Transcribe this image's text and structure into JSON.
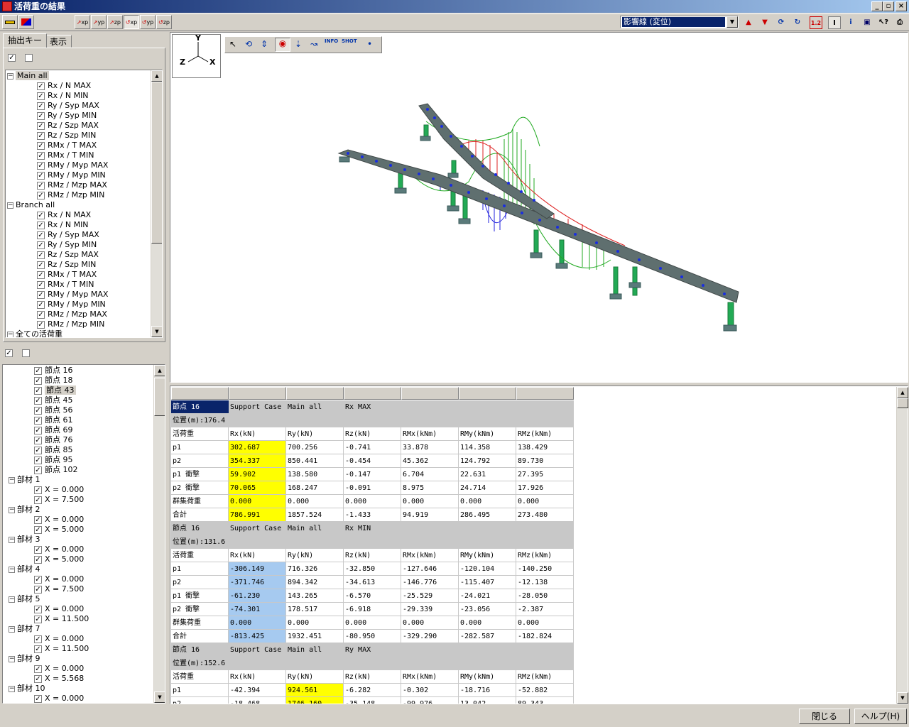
{
  "window": {
    "title": "活荷重の結果",
    "minimize": "_",
    "maximize": "▫",
    "close": "×"
  },
  "toolbar": {
    "axis_buttons": [
      "xp",
      "yp",
      "zp",
      "xp",
      "yp",
      "zp"
    ],
    "combo_value": "影響線 (変位)",
    "view_buttons": [
      "",
      "",
      "",
      "",
      "",
      "",
      "",
      "",
      "",
      "INFO",
      "SHOT",
      "•"
    ]
  },
  "tabs": [
    "抽出キー",
    "表示"
  ],
  "tree_top": {
    "groups": [
      {
        "label": "Main all",
        "items": [
          "Rx / N MAX",
          "Rx / N MIN",
          "Ry / Syp MAX",
          "Ry / Syp MIN",
          "Rz / Szp MAX",
          "Rz / Szp MIN",
          "RMx / T MAX",
          "RMx / T MIN",
          "RMy / Myp MAX",
          "RMy / Myp MIN",
          "RMz / Mzp MAX",
          "RMz / Mzp MIN"
        ]
      },
      {
        "label": "Branch all",
        "items": [
          "Rx / N MAX",
          "Rx / N MIN",
          "Ry / Syp MAX",
          "Ry / Syp MIN",
          "Rz / Szp MAX",
          "Rz / Szp MIN",
          "RMx / T MAX",
          "RMx / T MIN",
          "RMy / Myp MAX",
          "RMy / Myp MIN",
          "RMz / Mzp MAX",
          "RMz / Mzp MIN"
        ]
      }
    ],
    "partial_last": "全ての活荷重"
  },
  "tree_bottom": {
    "nodes": [
      "節点 16",
      "節点 18",
      "節点 43",
      "節点 45",
      "節点 56",
      "節点 61",
      "節点 69",
      "節点 76",
      "節点 85",
      "節点 95",
      "節点 102"
    ],
    "members": [
      {
        "label": "部材 1",
        "items": [
          "X = 0.000",
          "X = 7.500"
        ]
      },
      {
        "label": "部材 2",
        "items": [
          "X = 0.000",
          "X = 5.000"
        ]
      },
      {
        "label": "部材 3",
        "items": [
          "X = 0.000",
          "X = 5.000"
        ]
      },
      {
        "label": "部材 4",
        "items": [
          "X = 0.000",
          "X = 7.500"
        ]
      },
      {
        "label": "部材 5",
        "items": [
          "X = 0.000",
          "X = 11.500"
        ]
      },
      {
        "label": "部材 7",
        "items": [
          "X = 0.000",
          "X = 11.500"
        ]
      },
      {
        "label": "部材 9",
        "items": [
          "X = 0.000",
          "X = 5.568"
        ]
      },
      {
        "label": "部材 10",
        "items": [
          "X = 0.000"
        ]
      }
    ]
  },
  "axes_labels": {
    "y": "Y",
    "z": "Z",
    "x": "X"
  },
  "table": {
    "blocks": [
      {
        "header": [
          "節点 16",
          "Support Case",
          "Main all",
          "Rx MAX"
        ],
        "position": "位置(m):176.4",
        "columns": [
          "活荷重",
          "Rx(kN)",
          "Ry(kN)",
          "Rz(kN)",
          "RMx(kNm)",
          "RMy(kNm)",
          "RMz(kNm)"
        ],
        "rows": [
          [
            "p1",
            "302.687",
            "700.256",
            "-0.741",
            "33.878",
            "114.358",
            "138.429"
          ],
          [
            "p2",
            "354.337",
            "850.441",
            "-0.454",
            "45.362",
            "124.792",
            "89.730"
          ],
          [
            "p1 衝撃",
            "59.902",
            "138.580",
            "-0.147",
            "6.704",
            "22.631",
            "27.395"
          ],
          [
            "p2 衝撃",
            "70.065",
            "168.247",
            "-0.091",
            "8.975",
            "24.714",
            "17.926"
          ],
          [
            "群集荷重",
            "0.000",
            "0.000",
            "0.000",
            "0.000",
            "0.000",
            "0.000"
          ],
          [
            "合計",
            "786.991",
            "1857.524",
            "-1.433",
            "94.919",
            "286.495",
            "273.480"
          ]
        ]
      },
      {
        "header": [
          "節点 16",
          "Support Case",
          "Main all",
          "Rx MIN"
        ],
        "position": "位置(m):131.6",
        "columns": [
          "活荷重",
          "Rx(kN)",
          "Ry(kN)",
          "Rz(kN)",
          "RMx(kNm)",
          "RMy(kNm)",
          "RMz(kNm)"
        ],
        "rows": [
          [
            "p1",
            "-306.149",
            "716.326",
            "-32.850",
            "-127.646",
            "-120.104",
            "-140.250"
          ],
          [
            "p2",
            "-371.746",
            "894.342",
            "-34.613",
            "-146.776",
            "-115.407",
            "-12.138"
          ],
          [
            "p1 衝撃",
            "-61.230",
            "143.265",
            "-6.570",
            "-25.529",
            "-24.021",
            "-28.050"
          ],
          [
            "p2 衝撃",
            "-74.301",
            "178.517",
            "-6.918",
            "-29.339",
            "-23.056",
            "-2.387"
          ],
          [
            "群集荷重",
            "0.000",
            "0.000",
            "0.000",
            "0.000",
            "0.000",
            "0.000"
          ],
          [
            "合計",
            "-813.425",
            "1932.451",
            "-80.950",
            "-329.290",
            "-282.587",
            "-182.824"
          ]
        ]
      },
      {
        "header": [
          "節点 16",
          "Support Case",
          "Main all",
          "Ry MAX"
        ],
        "position": "位置(m):152.6",
        "columns": [
          "活荷重",
          "Rx(kN)",
          "Ry(kN)",
          "Rz(kN)",
          "RMx(kNm)",
          "RMy(kNm)",
          "RMz(kNm)"
        ],
        "rows": [
          [
            "p1",
            "-42.394",
            "924.561",
            "-6.282",
            "-0.302",
            "-18.716",
            "-52.882"
          ],
          [
            "p2",
            "-18.468",
            "1746.160",
            "-35.148",
            "-99.976",
            "13.042",
            "89.343"
          ]
        ]
      }
    ]
  },
  "buttons": {
    "close": "閉じる",
    "help": "ヘルプ(H)"
  }
}
